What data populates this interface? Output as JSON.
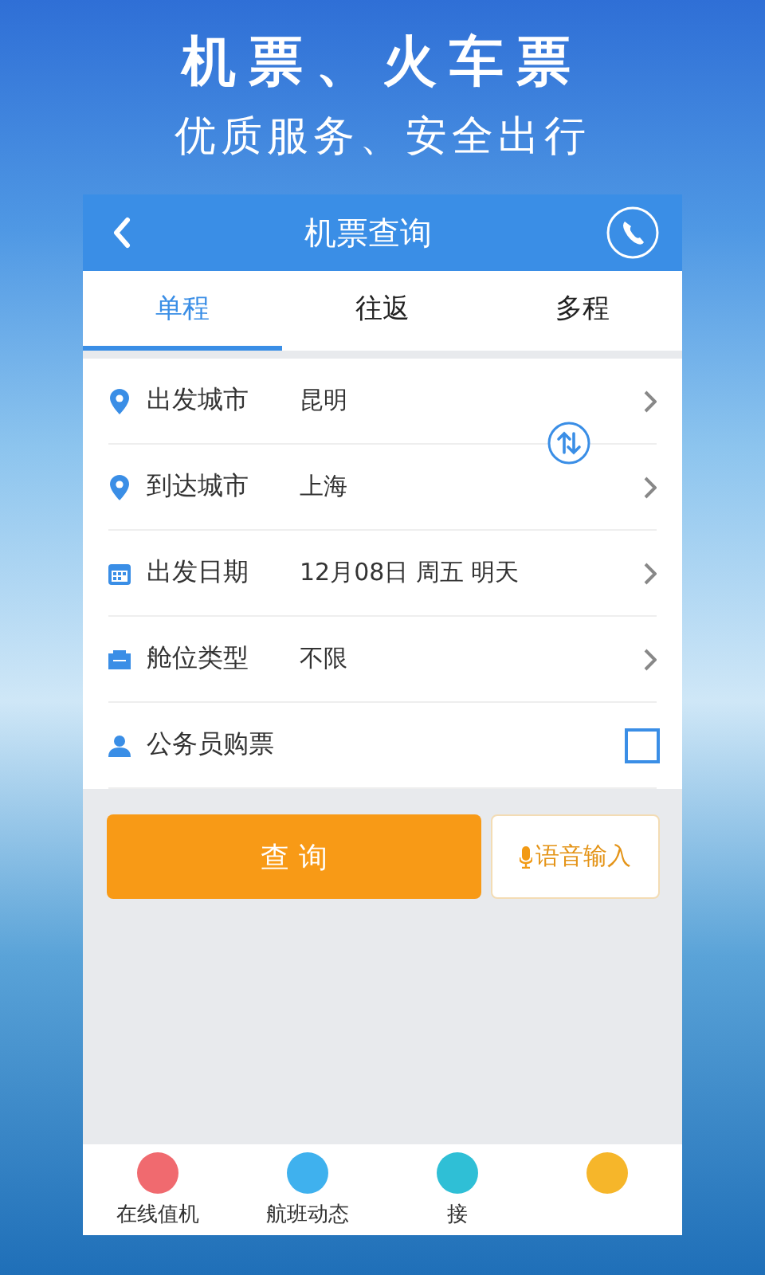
{
  "promo": {
    "headline": "机票、火车票",
    "tagline": "优质服务、安全出行"
  },
  "header": {
    "title": "机票查询"
  },
  "tabs": [
    {
      "label": "单程",
      "selected": true
    },
    {
      "label": "往返",
      "selected": false
    },
    {
      "label": "多程",
      "selected": false
    }
  ],
  "form_rows": [
    {
      "kind": "select",
      "label": "出发城市",
      "value": "昆明"
    },
    {
      "kind": "select",
      "label": "到达城市",
      "value": "上海"
    },
    {
      "kind": "select",
      "label": "出发日期",
      "value": "12月08日 周五 明天"
    },
    {
      "kind": "select",
      "label": "舱位类型",
      "value": "不限"
    },
    {
      "kind": "checkbox",
      "label": "公务员购票",
      "checked": false
    }
  ],
  "search_button": "查 询",
  "voice_button": "语音输入",
  "bottom_nav": [
    {
      "label": "在线值机",
      "color": "#f06a6f"
    },
    {
      "label": "航班动态",
      "color": "#3fb1ee"
    },
    {
      "label": "接",
      "color": "#2fbfd6"
    },
    {
      "color": "#f6b62a"
    }
  ]
}
